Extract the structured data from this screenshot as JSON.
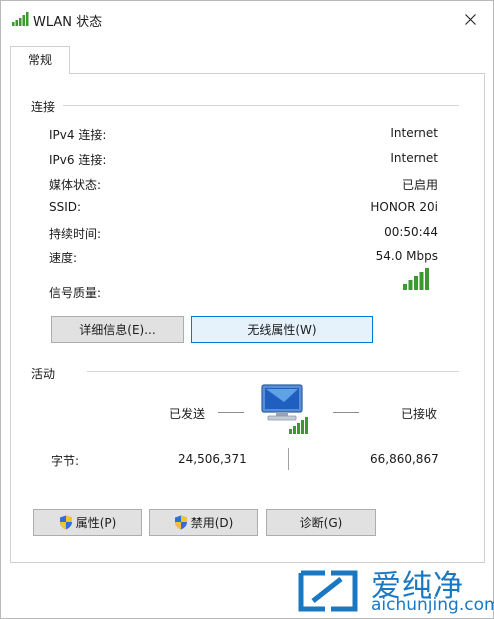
{
  "window": {
    "title": "WLAN 状态"
  },
  "tabs": [
    {
      "label": "常规"
    }
  ],
  "connection": {
    "section_label": "连接",
    "rows": [
      {
        "label": "IPv4 连接:",
        "value": "Internet"
      },
      {
        "label": "IPv6 连接:",
        "value": "Internet"
      },
      {
        "label": "媒体状态:",
        "value": "已启用"
      },
      {
        "label": "SSID:",
        "value": "HONOR 20i"
      },
      {
        "label": "持续时间:",
        "value": "00:50:44"
      },
      {
        "label": "速度:",
        "value": "54.0 Mbps"
      }
    ],
    "signal_label": "信号质量:",
    "signal_bars": 5,
    "buttons": {
      "details": "详细信息(E)...",
      "wireless_properties": "无线属性(W)"
    }
  },
  "activity": {
    "section_label": "活动",
    "sent_label": "已发送",
    "received_label": "已接收",
    "bytes_label": "字节:",
    "bytes_sent": "24,506,371",
    "bytes_received": "66,860,867"
  },
  "footer_buttons": {
    "properties": "属性(P)",
    "disable": "禁用(D)",
    "diagnose": "诊断(G)"
  },
  "watermark": {
    "text_cn": "爱纯净",
    "text_en": "aichunjing.com"
  },
  "colors": {
    "signal_green": "#3a9a2e",
    "focus_blue": "#0078d7",
    "watermark_blue": "#1a78c2"
  },
  "icons": [
    "wifi-signal-icon",
    "close-icon",
    "network-computer-icon",
    "shield-icon"
  ]
}
